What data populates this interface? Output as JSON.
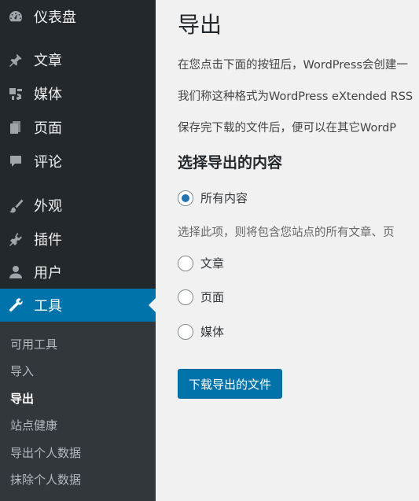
{
  "sidebar": {
    "dashboard": {
      "label": "仪表盘",
      "icon": "dashboard-icon"
    },
    "posts": {
      "label": "文章",
      "icon": "pin-icon"
    },
    "media": {
      "label": "媒体",
      "icon": "media-icon"
    },
    "pages": {
      "label": "页面",
      "icon": "page-icon"
    },
    "comments": {
      "label": "评论",
      "icon": "comment-icon"
    },
    "appearance": {
      "label": "外观",
      "icon": "brush-icon"
    },
    "plugins": {
      "label": "插件",
      "icon": "plug-icon"
    },
    "users": {
      "label": "用户",
      "icon": "user-icon"
    },
    "tools": {
      "label": "工具",
      "icon": "wrench-icon"
    },
    "submenu": [
      "可用工具",
      "导入",
      "导出",
      "站点健康",
      "导出个人数据",
      "抹除个人数据"
    ]
  },
  "main": {
    "title": "导出",
    "paragraphs": [
      "在您点击下面的按钮后，WordPress会创建一",
      "我们称这种格式为WordPress eXtended RSS",
      "保存完下载的文件后，便可以在其它WordP"
    ],
    "section_title": "选择导出的内容",
    "options": {
      "all": "所有内容",
      "posts": "文章",
      "pages": "页面",
      "media": "媒体"
    },
    "selected": "all",
    "hint": "选择此项，则将包含您站点的所有文章、页",
    "download_button": "下载导出的文件"
  },
  "colors": {
    "sidebar_bg": "#23282d",
    "submenu_bg": "#32373c",
    "accent": "#0073aa",
    "content_bg": "#f1f1f1"
  }
}
